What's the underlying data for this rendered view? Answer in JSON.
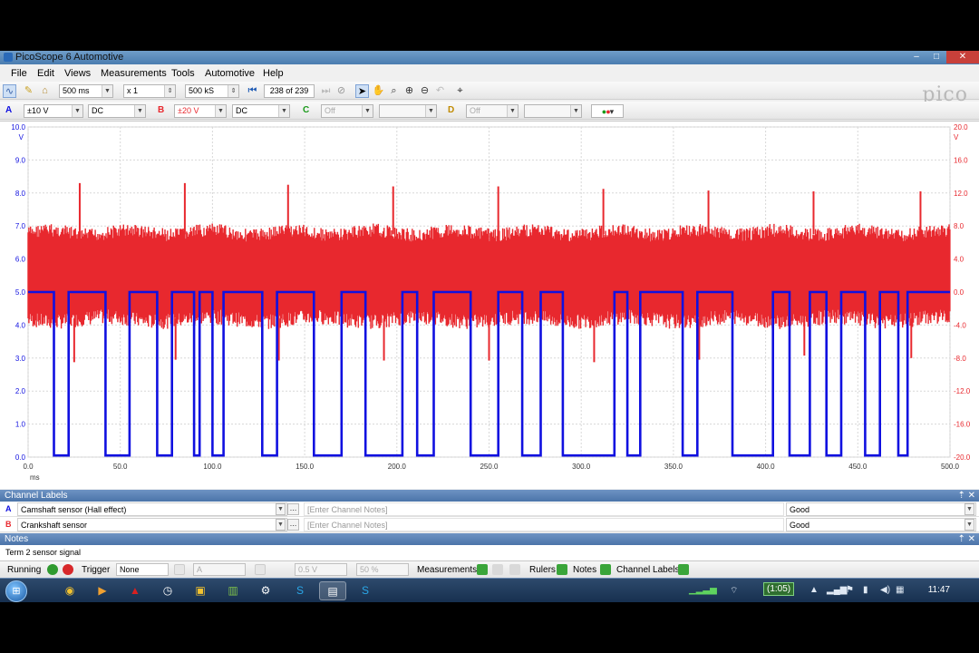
{
  "window": {
    "title": "PicoScope 6 Automotive"
  },
  "menu": [
    "File",
    "Edit",
    "Views",
    "Measurements",
    "Tools",
    "Automotive",
    "Help"
  ],
  "toolbar": {
    "timebase": "500 ms",
    "zoom": "x 1",
    "samples": "500 kS",
    "buffer": "238 of 239"
  },
  "channels_bar": {
    "a_label": "A",
    "a_range": "±10 V",
    "a_coupling": "DC",
    "b_label": "B",
    "b_range": "±20 V",
    "b_coupling": "DC",
    "c_label": "C",
    "c_range": "Off",
    "d_label": "D",
    "d_range": "Off"
  },
  "logo": "pico",
  "chart_data": {
    "type": "line",
    "xlabel": "ms",
    "xlim": [
      0,
      500
    ],
    "x_ticks": [
      "0.0",
      "50.0",
      "100.0",
      "150.0",
      "200.0",
      "250.0",
      "300.0",
      "350.0",
      "400.0",
      "450.0",
      "500.0"
    ],
    "left_axis": {
      "unit": "V",
      "ylim": [
        0,
        10
      ],
      "ticks": [
        "0.0",
        "1.0",
        "2.0",
        "3.0",
        "4.0",
        "5.0",
        "6.0",
        "7.0",
        "8.0",
        "9.0",
        "10.0"
      ]
    },
    "right_axis": {
      "unit": "V",
      "ylim": [
        -20,
        20
      ],
      "ticks": [
        "-20.0",
        "-16.0",
        "-12.0",
        "-8.0",
        "-4.0",
        "0.0",
        "4.0",
        "8.0",
        "12.0",
        "16.0",
        "20.0"
      ]
    },
    "grid": true,
    "series": [
      {
        "name": "Camshaft sensor (Hall effect)",
        "color": "#1010e0",
        "axis": "left",
        "high": 5.0,
        "low": 0.05,
        "low_intervals": [
          [
            14,
            22
          ],
          [
            42,
            55
          ],
          [
            70,
            78
          ],
          [
            90,
            93
          ],
          [
            100,
            106
          ],
          [
            127,
            135
          ],
          [
            155,
            170
          ],
          [
            183,
            203
          ],
          [
            211,
            220
          ],
          [
            240,
            255
          ],
          [
            268,
            278
          ],
          [
            290,
            318
          ],
          [
            325,
            332
          ],
          [
            355,
            363
          ],
          [
            382,
            404
          ],
          [
            413,
            424
          ],
          [
            433,
            441
          ],
          [
            454,
            462
          ],
          [
            472,
            477
          ]
        ]
      },
      {
        "name": "Crankshaft sensor",
        "color": "#e8282e",
        "axis": "right",
        "band_top": 8.0,
        "band_bottom": -4.2,
        "spikes_top": [
          [
            28,
            13.2
          ],
          [
            85,
            13.2
          ],
          [
            141,
            13.0
          ],
          [
            198,
            12.8
          ],
          [
            255,
            12.8
          ],
          [
            312,
            12.5
          ],
          [
            369,
            12.3
          ],
          [
            426,
            12.2
          ],
          [
            484,
            12.2
          ]
        ],
        "spikes_bottom": [
          [
            25,
            -8.5
          ],
          [
            80,
            -8.2
          ],
          [
            136,
            -8.3
          ],
          [
            193,
            -8.3
          ],
          [
            250,
            -8.3
          ],
          [
            307,
            -8.5
          ],
          [
            364,
            -8.2
          ],
          [
            421,
            -7.7
          ],
          [
            479,
            -8.0
          ]
        ]
      }
    ]
  },
  "channel_labels": {
    "header": "Channel Labels",
    "rows": [
      {
        "letter": "A",
        "label": "Camshaft sensor (Hall effect)",
        "notes_placeholder": "[Enter Channel Notes]",
        "status": "Good"
      },
      {
        "letter": "B",
        "label": "Crankshaft sensor",
        "notes_placeholder": "[Enter Channel Notes]",
        "status": "Good"
      }
    ]
  },
  "notes": {
    "header": "Notes",
    "text": "Term 2 sensor signal"
  },
  "statusbar": {
    "running": "Running",
    "trigger_label": "Trigger",
    "trigger_mode": "None",
    "disabled_1": "A",
    "disabled_2": "0.5 V",
    "disabled_3": "50 %",
    "measurements": "Measurements",
    "rulers": "Rulers",
    "notes": "Notes",
    "channel_labels": "Channel Labels"
  },
  "taskbar": {
    "clock": "11:47",
    "recording": "(1:05)"
  },
  "colors": {
    "blue": "#1010e0",
    "red": "#e8282e",
    "panel": "#5a80b4"
  }
}
